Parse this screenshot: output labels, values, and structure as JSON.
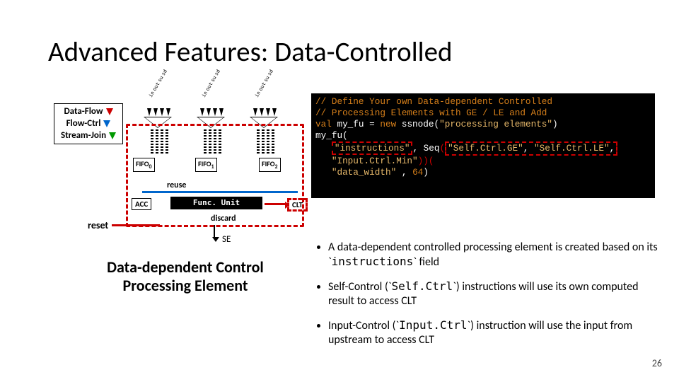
{
  "title": "Advanced Features: Data-Controlled",
  "slide_number": "26",
  "legend": {
    "data_flow": "Data-Flow",
    "flow_ctrl": "Flow-Ctrl",
    "stream_join": "Stream-Join"
  },
  "diagram": {
    "input_labels": [
      "in",
      "out",
      "su",
      "sd"
    ],
    "fifo0": "FIFO",
    "fifo1": "FIFO",
    "fifo2": "FIFO",
    "fifo0_sub": "0",
    "fifo1_sub": "1",
    "fifo2_sub": "2",
    "reuse": "reuse",
    "acc": "ACC",
    "func_unit": "Func. Unit",
    "clt": "CLT",
    "discard": "discard",
    "reset": "reset",
    "se": "SE"
  },
  "caption_line1": "Data-dependent Control",
  "caption_line2": "Processing Element",
  "code": {
    "c1": "// Define Your own Data-dependent Controlled",
    "c2": "// Processing Elements with GE / LE and Add",
    "c3a": "val",
    "c3b": " my_fu = ",
    "c3c": "new",
    "c3d": " ssnode(",
    "c3e": "\"processing elements\"",
    "c3f": ")",
    "c4": "my_fu(",
    "c5a": "   ",
    "c5b": "\"instructions\"",
    "c5c": ", Seq",
    "c5d": "(",
    "c5e1": "\"Self.Ctrl.GE\"",
    "c5e2": ", ",
    "c5e3": "\"Self.Ctrl.LE\"",
    "c5e4": ",",
    "c6a": "   ",
    "c6b": "\"Input.Ctrl.Min\"",
    "c6c": "))(",
    "c7a": "   ",
    "c7b": "\"data_width\"",
    "c7c": " , ",
    "c7d": "64",
    "c7e": ")"
  },
  "bullets": {
    "b1a": "A data-dependent controlled processing element is created based on its `",
    "b1b": "instructions",
    "b1c": "` field",
    "b2a": "Self-Control (`",
    "b2b": "Self.Ctrl",
    "b2c": "`) instructions will use its own computed result to access CLT",
    "b3a": "Input-Control (`",
    "b3b": "Input.Ctrl",
    "b3c": "`) instruction will use the input from upstream to access CLT"
  }
}
